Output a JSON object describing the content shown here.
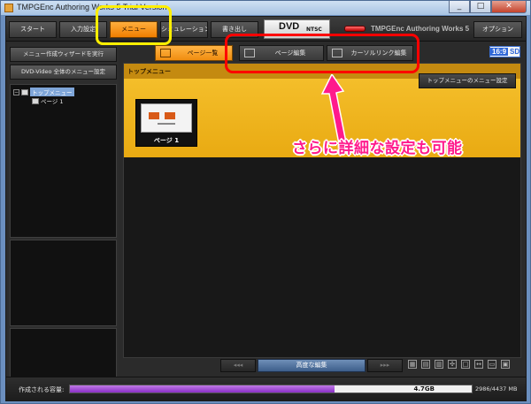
{
  "window": {
    "title": "TMPGEnc Authoring Works 5 Trial Version",
    "buttons": [
      "_",
      "□",
      "✕"
    ]
  },
  "toolbar": {
    "buttons": [
      {
        "label": "スタート",
        "active": false
      },
      {
        "label": "入力設定",
        "active": false
      },
      {
        "label": "メニュー",
        "active": true
      },
      {
        "label": "シミュレーション",
        "active": false
      },
      {
        "label": "書き出し",
        "active": false
      }
    ],
    "disc": {
      "format": "DVD",
      "standard": "NTSC"
    },
    "brand": "TMPGEnc Authoring Works 5",
    "options_label": "オプション"
  },
  "left_panel": {
    "wizard_button": "メニュー作成ウィザードを実行",
    "global_settings_button": "DVD-Video 全体のメニュー設定",
    "tree": [
      {
        "label": "トップメニュー",
        "selected": true,
        "expander": "−"
      },
      {
        "label": "ページ 1",
        "selected": false
      }
    ]
  },
  "tabs": [
    {
      "label": "ページ一覧",
      "active": true,
      "icon": "page-list-icon"
    },
    {
      "label": "ページ編集",
      "active": false,
      "icon": "page-edit-icon"
    },
    {
      "label": "カーソルリンク編集",
      "active": false,
      "icon": "cursor-link-icon"
    }
  ],
  "aspect_badge": {
    "ratio": "16:9",
    "quality": "SD"
  },
  "menu_strip": {
    "title": "トップメニュー",
    "settings_button": "トップメニューのメニュー設定",
    "pages": [
      {
        "label": "ページ 1"
      }
    ]
  },
  "nav": {
    "prev": "◂◂◂",
    "advanced": "高度な編集",
    "next": "▸▸▸",
    "view_icons": [
      "grid-icon",
      "grid2-icon",
      "grid3-icon",
      "crosshair-icon",
      "fit-icon",
      "resize-icon",
      "align-icon",
      "layers-icon"
    ]
  },
  "status": {
    "label": "作成される容量:",
    "used_fraction": 0.659,
    "value_label": "4.7GB",
    "detail": "2986/4437 MB"
  },
  "annotation": {
    "text": "さらに詳細な設定も可能"
  },
  "colors": {
    "accent_orange": "#f08d10",
    "menu_strip_yellow": "#f6c22f",
    "capacity_purple": "#8a2fc7",
    "annotation_pink": "#ff1a8c",
    "annotation_red": "#ff0000",
    "annotation_yellow": "#ffef00"
  }
}
